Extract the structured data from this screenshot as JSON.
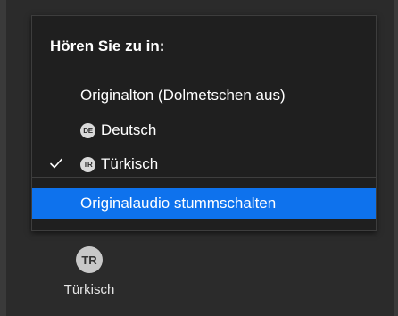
{
  "menu": {
    "title": "Hören Sie zu in:",
    "items": [
      {
        "label": "Originalton (Dolmetschen aus)",
        "badge": "",
        "checked": false
      },
      {
        "label": "Deutsch",
        "badge": "DE",
        "checked": false
      },
      {
        "label": "Türkisch",
        "badge": "TR",
        "checked": true
      }
    ],
    "mute_original": {
      "label": "Originalaudio stummschalten",
      "highlighted": true
    }
  },
  "language_button": {
    "badge": "TR",
    "label": "Türkisch"
  },
  "colors": {
    "background": "#2b2b2b",
    "menu_background": "#1f1f1f",
    "highlight": "#0e72ed",
    "text": "#ffffff",
    "badge": "#d9d9d9"
  }
}
